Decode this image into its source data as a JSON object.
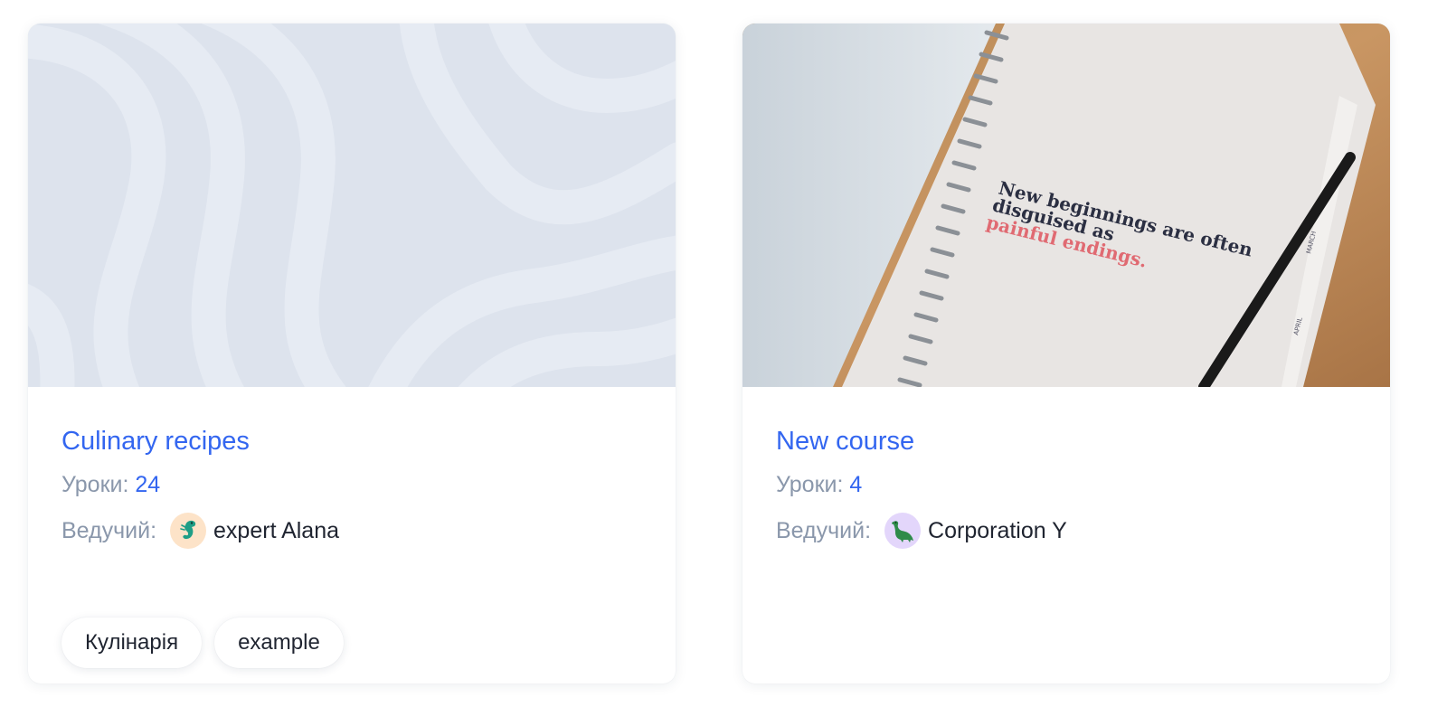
{
  "courses": [
    {
      "title": "Culinary recipes",
      "lessons_label": "Уроки:",
      "lessons_count": "24",
      "host_label": "Ведучий:",
      "host_name": "expert Alana",
      "avatar_icon": "seahorse-icon",
      "avatar_bg": "#fde3c8",
      "cover": "wavy-pattern-placeholder",
      "tags": [
        "Кулінарія",
        "example"
      ]
    },
    {
      "title": "New course",
      "lessons_label": "Уроки:",
      "lessons_count": "4",
      "host_label": "Ведучий:",
      "host_name": "Corporation Y",
      "avatar_icon": "dinosaur-icon",
      "avatar_bg": "#e3d6fb",
      "cover": "notebook-photo",
      "cover_text": {
        "line1": "New beginnings are often",
        "line2": "disguised as",
        "line3": "painful endings.",
        "tab1": "MARCH",
        "tab2": "APRIL"
      },
      "tags": []
    }
  ],
  "colors": {
    "accent": "#3366f0",
    "muted": "#8a97ab",
    "text": "#1f2430",
    "pink_text": "#e06a72"
  }
}
